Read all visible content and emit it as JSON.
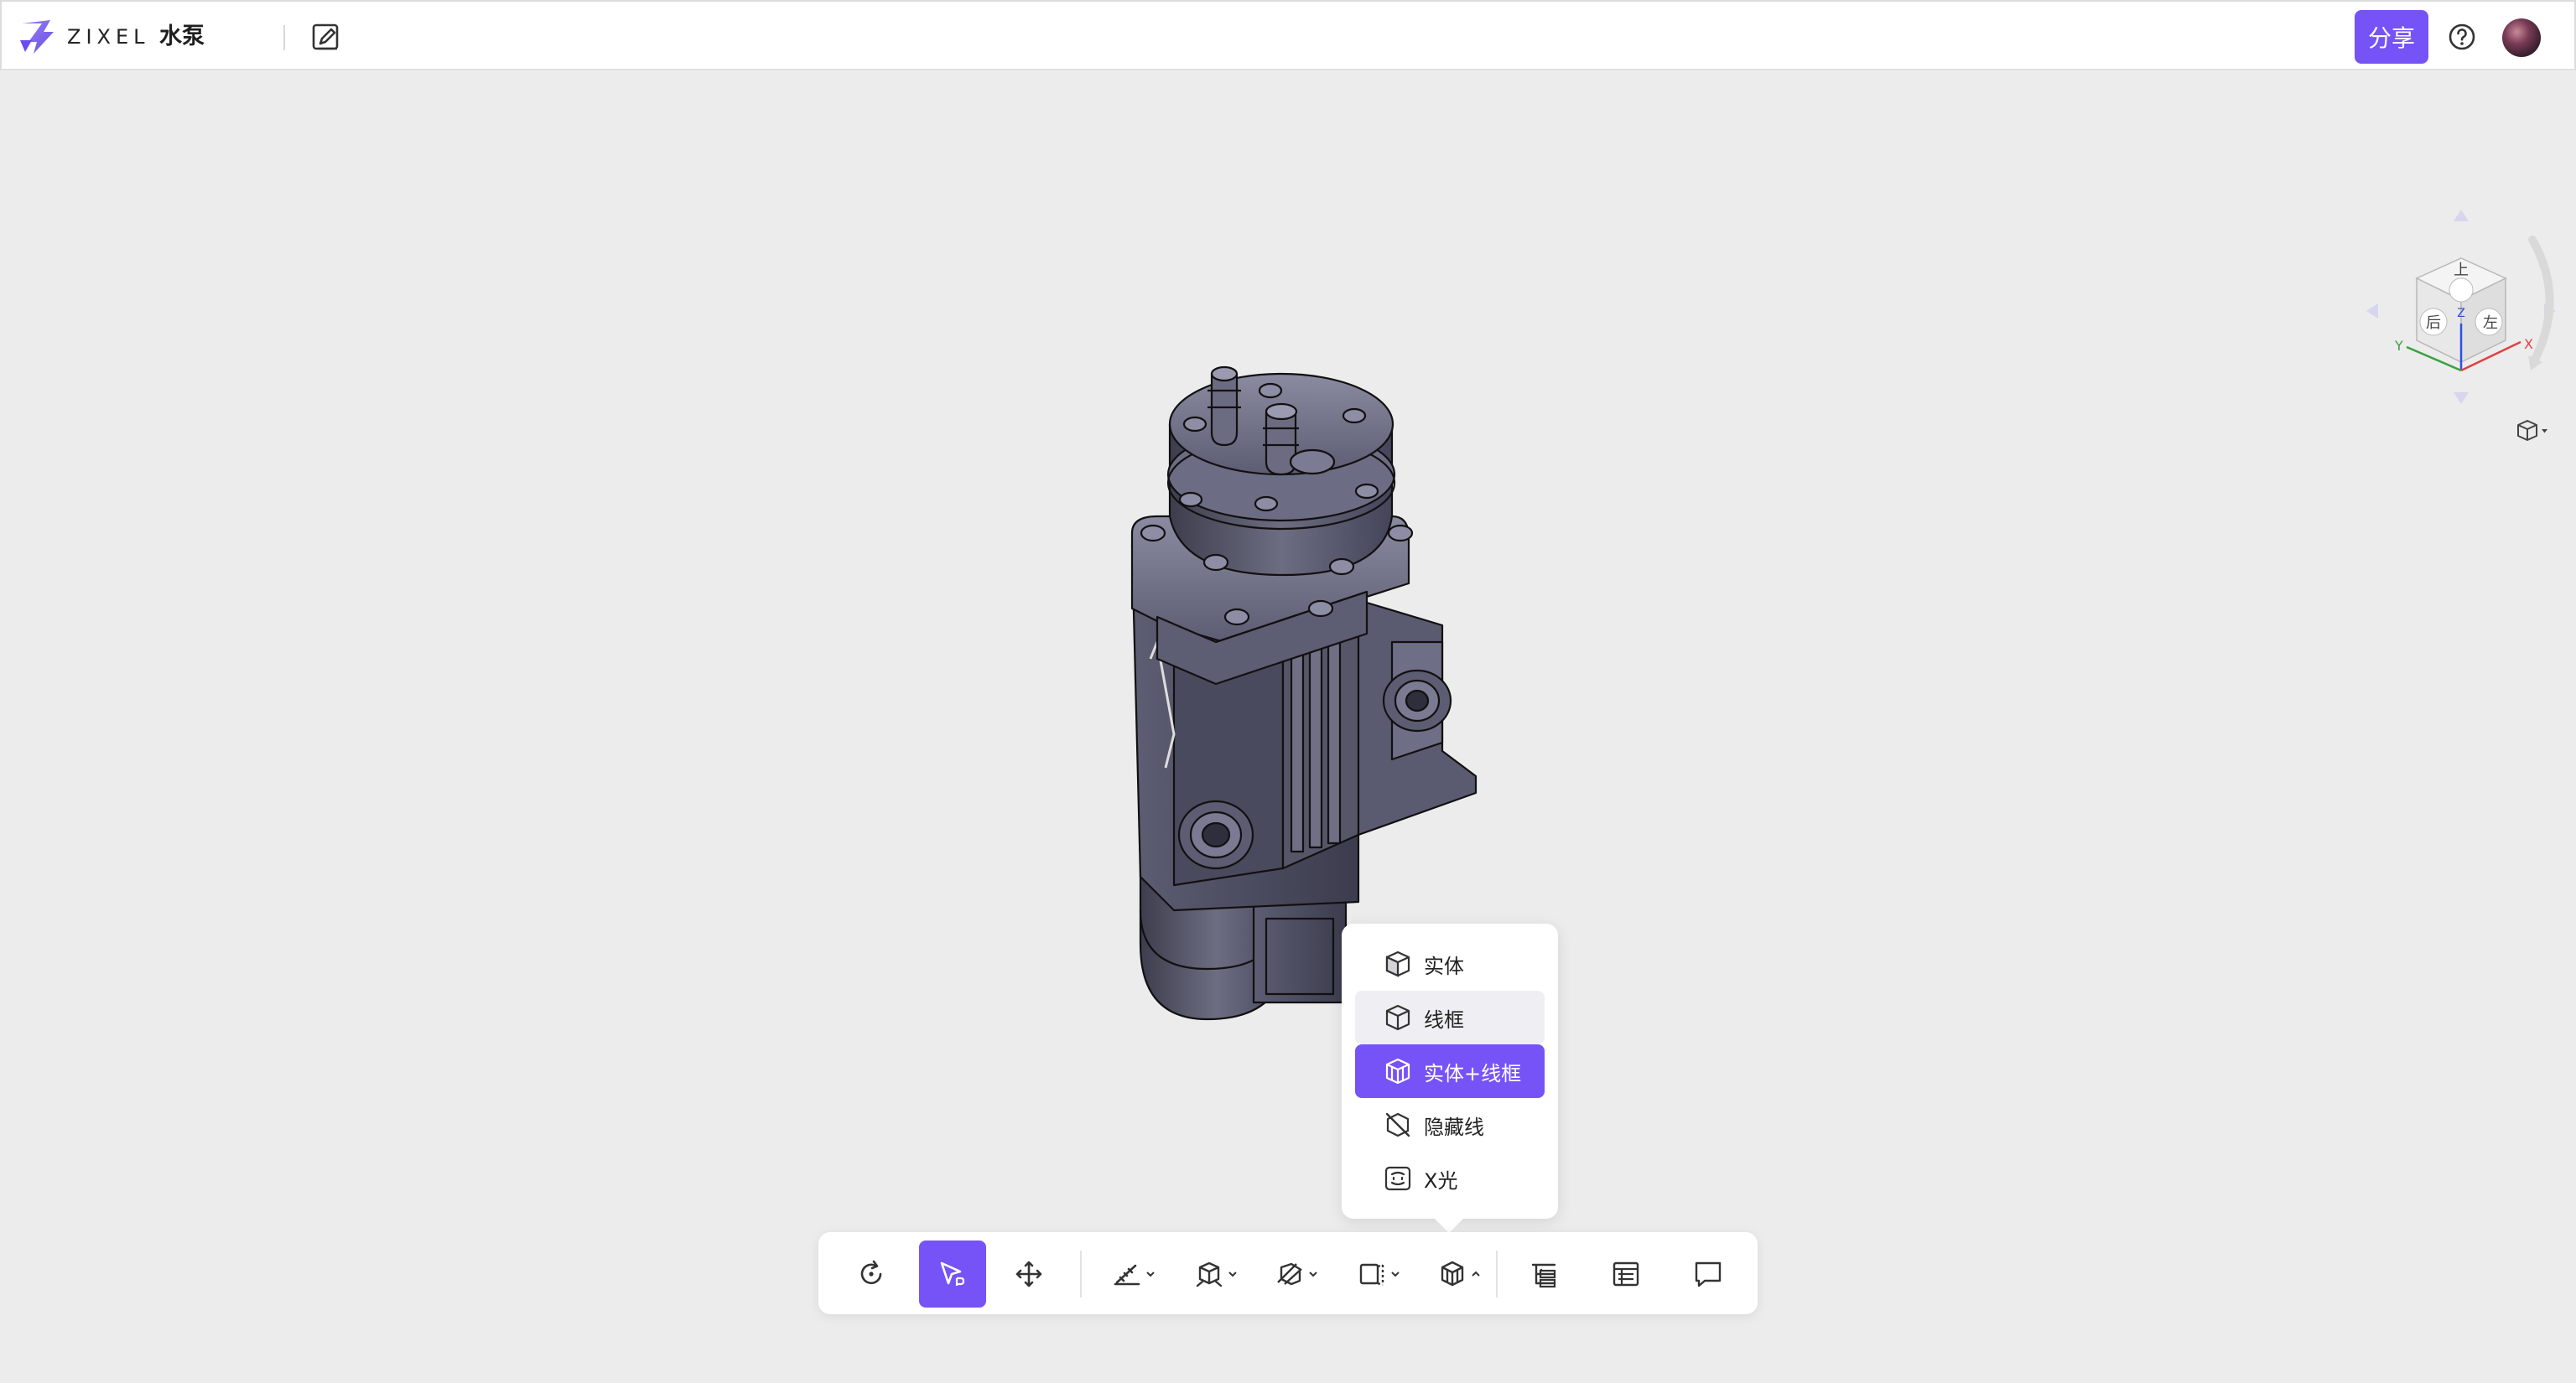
{
  "app": {
    "brand": "ZIXEL",
    "doc_title": "水泵"
  },
  "header": {
    "share_label": "分享"
  },
  "viewcube": {
    "faces": {
      "top": "上",
      "back": "后",
      "left": "左",
      "z_label": "Z"
    },
    "axes": {
      "x": "X",
      "y": "Y"
    }
  },
  "render_menu": {
    "items": [
      {
        "label": "实体",
        "icon": "solid-icon"
      },
      {
        "label": "线框",
        "icon": "wireframe-icon"
      },
      {
        "label": "实体+线框",
        "icon": "solid-wireframe-icon"
      },
      {
        "label": "隐藏线",
        "icon": "hidden-line-icon"
      },
      {
        "label": "X光",
        "icon": "xray-icon"
      }
    ],
    "hovered_index": 1,
    "selected_index": 2
  },
  "toolbar": {
    "tools": [
      "reset-view-icon",
      "select-icon",
      "pan-icon",
      "measure-icon",
      "explode-icon",
      "section-icon",
      "view-icon",
      "render-mode-icon",
      "structure-tree-icon",
      "properties-icon",
      "comment-icon"
    ],
    "active_tool": "select-icon"
  },
  "colors": {
    "accent": "#7653f6",
    "background": "#ececec",
    "model": "#5a5a6e"
  }
}
